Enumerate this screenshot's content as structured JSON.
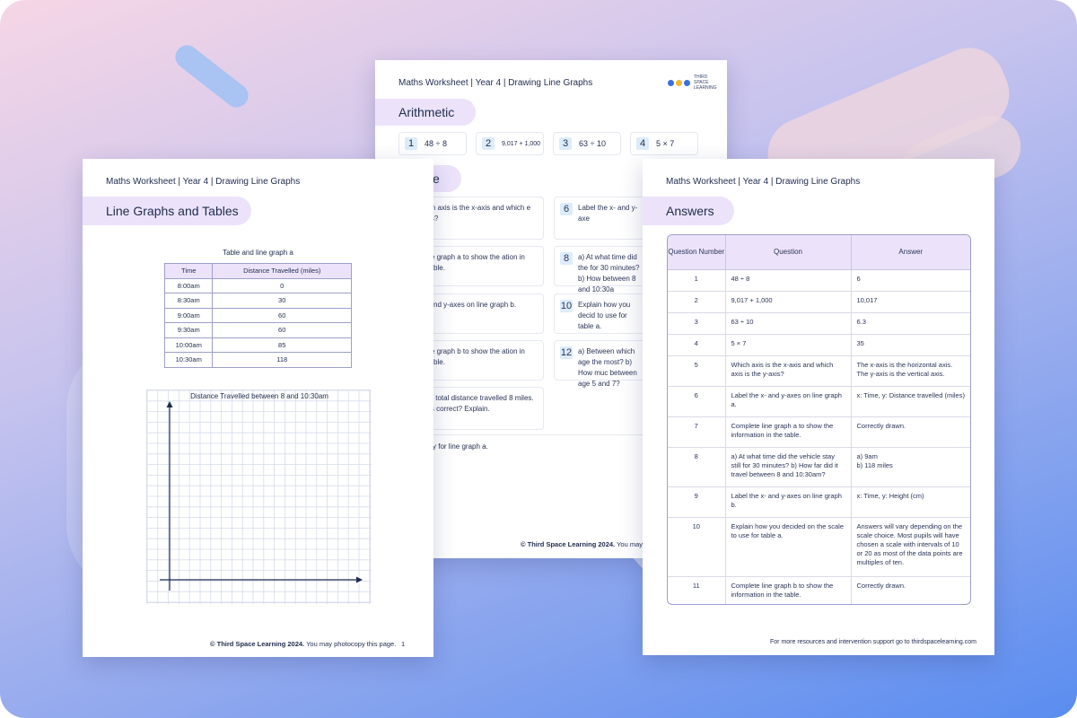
{
  "colors": {
    "accent_lavender": "#ece3fb",
    "number_badge": "#dcecfa",
    "text_navy": "#1f2b4d",
    "table_border": "#9d9fc9"
  },
  "back_sheet": {
    "header": "Maths Worksheet | Year 4 |  Drawing Line Graphs",
    "logo_text": "THIRD SPACE LEARNING",
    "section_title": "Arithmetic",
    "section2_title": "e",
    "arithmetic": [
      {
        "num": "1",
        "expr": "48 ÷ 8"
      },
      {
        "num": "2",
        "expr": "9,017 + 1,000"
      },
      {
        "num": "3",
        "expr": "63 ÷ 10"
      },
      {
        "num": "4",
        "expr": "5 × 7"
      }
    ],
    "left_cards": [
      "Which axis is the x-axis and which e y-axis?",
      "te line graph a to show the ation in the table.",
      "e x- and y-axes on line graph b.",
      "te line graph b to show the ation in the table.",
      "a, the total distance travelled 8 miles. Is this correct? Explain."
    ],
    "right_cards": [
      {
        "num": "6",
        "text": "Label the x- and y-axe"
      },
      {
        "num": "8",
        "text": "a) At what time did the for 30 minutes? b) How between 8 and 10:30a"
      },
      {
        "num": "10",
        "text": "Explain how you decid to use for table a."
      },
      {
        "num": "12",
        "text": "a) Between which age the most? b) How muc between age 5 and 7?"
      }
    ],
    "bottom_line": "a story for line graph a.",
    "footer_bold": "© Third Space Learning 2024.",
    "footer_rest": " You may phe"
  },
  "left_sheet": {
    "header": "Maths Worksheet | Year 4 |  Drawing Line Graphs",
    "section_title": "Line Graphs and Tables",
    "table_caption": "Table and line graph a",
    "table_headers": [
      "Time",
      "Distance Travelled (miles)"
    ],
    "table_rows": [
      [
        "8:00am",
        "0"
      ],
      [
        "8:30am",
        "30"
      ],
      [
        "9:00am",
        "60"
      ],
      [
        "9:30am",
        "60"
      ],
      [
        "10:00am",
        "85"
      ],
      [
        "10:30am",
        "118"
      ]
    ],
    "graph_title": "Distance Travelled between 8 and 10:30am",
    "footer_bold": "© Third Space Learning 2024.",
    "footer_rest": " You may photocopy this page.",
    "page_number": "1"
  },
  "right_sheet": {
    "header": "Maths Worksheet | Year 4 |  Drawing Line Graphs",
    "section_title": "Answers",
    "table_headers": [
      "Question Number",
      "Question",
      "Answer"
    ],
    "rows": [
      {
        "n": "1",
        "q": "48 ÷ 8",
        "a": "6"
      },
      {
        "n": "2",
        "q": "9,017 + 1,000",
        "a": "10,017"
      },
      {
        "n": "3",
        "q": "63 ÷ 10",
        "a": "6.3"
      },
      {
        "n": "4",
        "q": "5 × 7",
        "a": "35"
      },
      {
        "n": "5",
        "q": "Which axis is the x-axis and which axis is the y-axis?",
        "a": "The x-axis is the horizontal axis. The y-axis is the vertical axis."
      },
      {
        "n": "6",
        "q": "Label the x- and y-axes on line graph a.",
        "a": "x: Time, y: Distance travelled (miles)"
      },
      {
        "n": "7",
        "q": "Complete line graph a to show the information in the table.",
        "a": "Correctly drawn."
      },
      {
        "n": "8",
        "q": "a) At what time did the vehicle stay still for 30 minutes? b) How far did it travel between 8 and 10:30am?",
        "a": "a) 9am\nb) 118 miles"
      },
      {
        "n": "9",
        "q": "Label the x- and y-axes on line graph b.",
        "a": "x: Time, y: Height (cm)"
      },
      {
        "n": "10",
        "q": "Explain how you decided on the scale\nto use for table a.",
        "a": "Answers will vary depending on the scale choice. Most pupils will have chosen a scale with intervals of 10 or 20 as most of the data points are multiples of ten."
      },
      {
        "n": "11",
        "q": "Complete line graph b to show the information in the table.",
        "a": "Correctly drawn."
      }
    ],
    "footer": "For more resources and intervention support go to thirdspacelearning.com"
  }
}
